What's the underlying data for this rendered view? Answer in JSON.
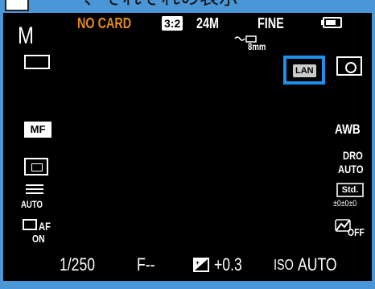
{
  "banner": {
    "text": "〜〜、それぞれの表示"
  },
  "top": {
    "mode": "M",
    "card_status": "NO CARD",
    "aspect": "3:2",
    "image_size": "24M",
    "quality": "FINE",
    "focal_length": "8mm"
  },
  "left": {
    "focus_mode": "MF",
    "face_value": "AUTO",
    "af_label": "AF",
    "af_value": "ON"
  },
  "right": {
    "lan": "LAN",
    "white_balance": "AWB",
    "dro": "DRO",
    "dro_value": "AUTO",
    "creative_style": "Std.",
    "creative_adjust": "±0±0±0",
    "effect_value": "OFF"
  },
  "bottom": {
    "shutter": "1/250",
    "aperture": "F--",
    "exposure_comp": "+0.3",
    "iso_label": "ISO",
    "iso_value": "AUTO"
  },
  "colors": {
    "background": "#000000",
    "frame": "#4a96d6",
    "highlight": "#1f8fe8",
    "warning": "#e08a1e"
  }
}
